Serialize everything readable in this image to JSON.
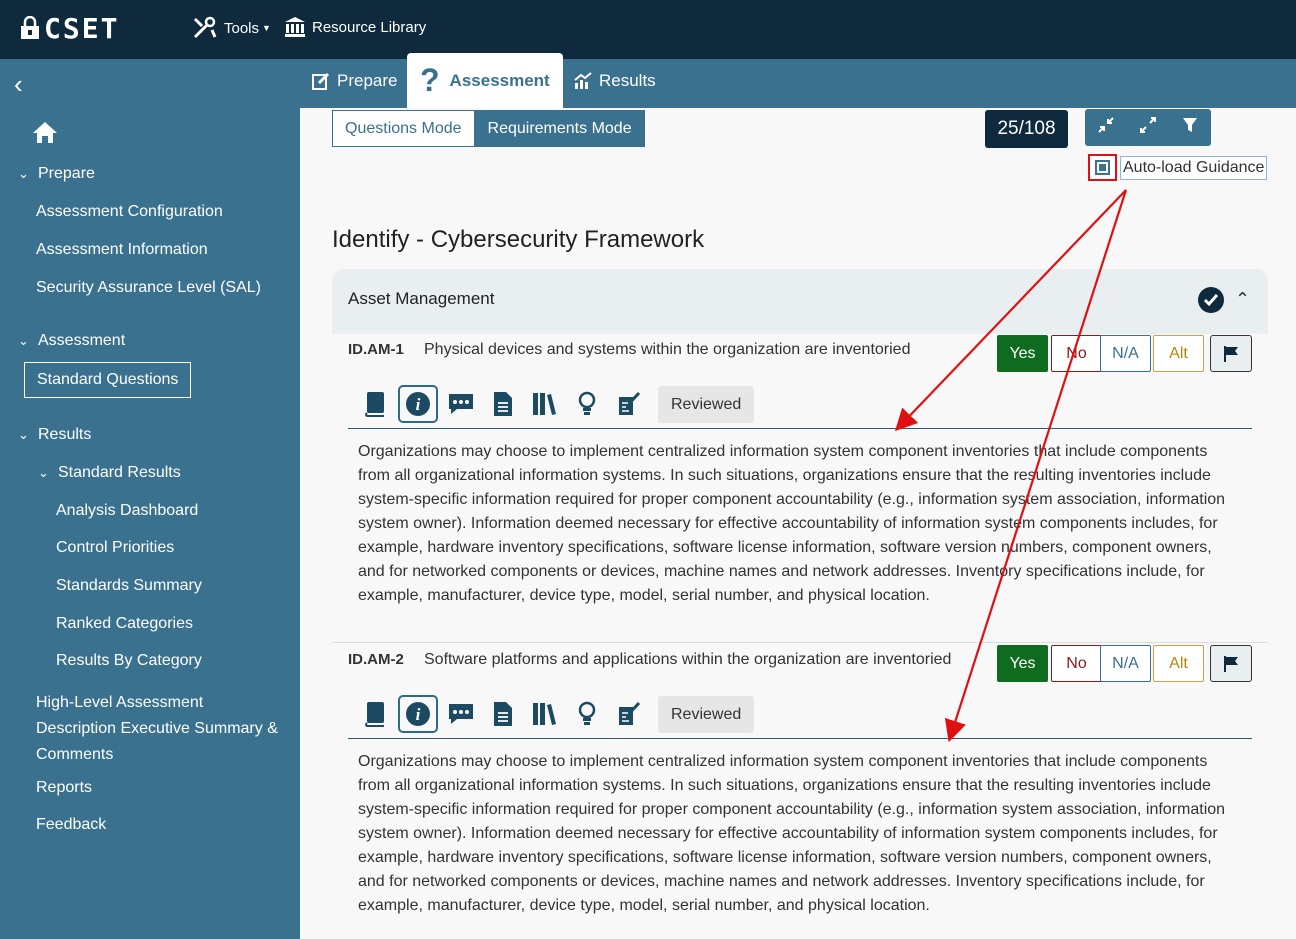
{
  "app": {
    "logo": "CSET"
  },
  "topnav": {
    "tools": "Tools",
    "resource_library": "Resource Library"
  },
  "tabs": {
    "prepare": "Prepare",
    "assessment": "Assessment",
    "results": "Results"
  },
  "sidebar": {
    "prepare": "Prepare",
    "assessment_configuration": "Assessment Configuration",
    "assessment_information": "Assessment Information",
    "sal": "Security Assurance Level (SAL)",
    "assessment": "Assessment",
    "standard_questions": "Standard Questions",
    "results": "Results",
    "standard_results": "Standard Results",
    "analysis_dashboard": "Analysis Dashboard",
    "control_priorities": "Control Priorities",
    "standards_summary": "Standards Summary",
    "ranked_categories": "Ranked Categories",
    "results_by_category": "Results By Category",
    "high_level_line1": "High-Level Assessment",
    "high_level_line2": "Description Executive Summary &",
    "high_level_line3": "Comments",
    "reports": "Reports",
    "feedback": "Feedback"
  },
  "toolbar": {
    "questions_mode": "Questions Mode",
    "requirements_mode": "Requirements Mode",
    "counter": "25/108",
    "autoload_label": "Auto-load Guidance"
  },
  "section_title": "Identify - Cybersecurity Framework",
  "group": {
    "title": "Asset Management"
  },
  "answers": {
    "yes": "Yes",
    "no": "No",
    "na": "N/A",
    "alt": "Alt"
  },
  "reviewed_label": "Reviewed",
  "questions": [
    {
      "id": "ID.AM-1",
      "text": "Physical devices and systems within the organization are inventoried",
      "guidance": "Organizations may choose to implement centralized information system component inventories that include components from all organizational information systems. In such situations, organizations ensure that the resulting inventories include system-specific information required for proper component accountability (e.g., information system association, information system owner). Information deemed necessary for effective accountability of information system components includes, for example, hardware inventory specifications, software license information, software version numbers, component owners, and for networked components or devices, machine names and network addresses. Inventory specifications include, for example, manufacturer, device type, model, serial number, and physical location."
    },
    {
      "id": "ID.AM-2",
      "text": "Software platforms and applications within the organization are inventoried",
      "guidance": "Organizations may choose to implement centralized information system component inventories that include components from all organizational information systems. In such situations, organizations ensure that the resulting inventories include system-specific information required for proper component accountability (e.g., information system association, information system owner). Information deemed necessary for effective accountability of information system components includes, for example, hardware inventory specifications, software license information, software version numbers, component owners, and for networked components or devices, machine names and network addresses. Inventory specifications include, for example, manufacturer, device type, model, serial number, and physical location."
    }
  ],
  "colors": {
    "topbar": "#0e2a3c",
    "primary": "#3a718f",
    "yes": "#0f6b1e",
    "no": "#8b1a1a",
    "alt": "#b8860b",
    "annotation": "#e01010"
  }
}
